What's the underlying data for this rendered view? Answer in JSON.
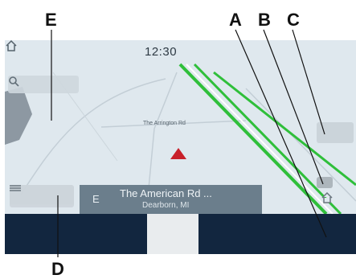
{
  "callouts": {
    "e": "E",
    "a": "A",
    "b": "B",
    "c": "C",
    "d": "D"
  },
  "status_bar": {
    "time": "12:30",
    "home_icon": "home-icon"
  },
  "map": {
    "road_label": "The Arrington Rd"
  },
  "search": {
    "icon": "search-icon"
  },
  "menu": {
    "icon": "menu-icon"
  },
  "turn_banner": {
    "direction": "E",
    "street": "The American Rd ...",
    "city": "Dearborn, MI"
  },
  "colors": {
    "route": "#2fbf3a",
    "map_bg": "#dfe8ee",
    "vehicle_arrow": "#c8202a",
    "bottom_bar": "#12263f"
  }
}
